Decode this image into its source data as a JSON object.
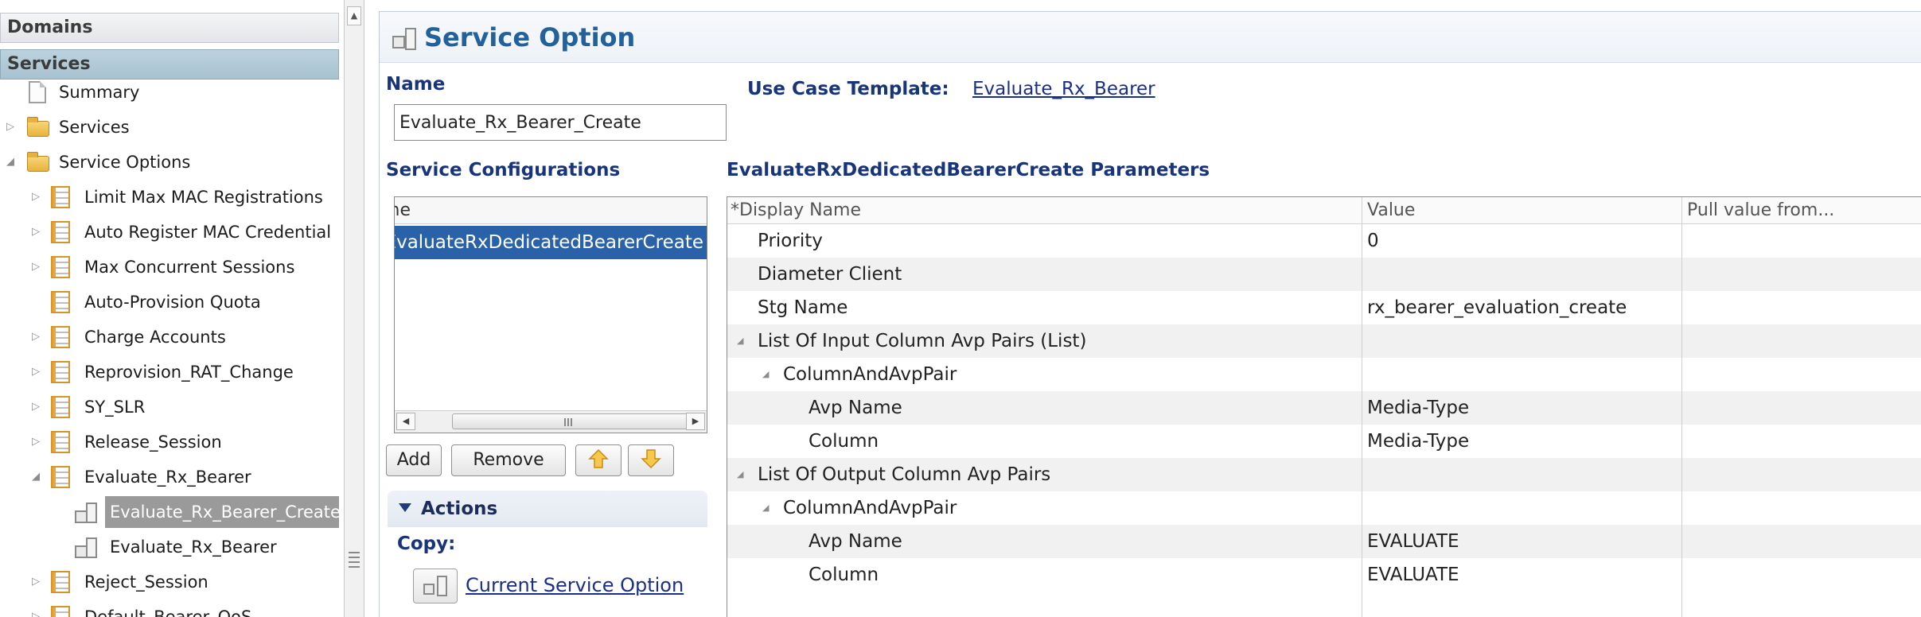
{
  "nav": {
    "domains_label": "Domains",
    "services_label": "Services",
    "tree": [
      {
        "label": "Summary"
      },
      {
        "label": "Services"
      },
      {
        "label": "Service Options"
      },
      {
        "label": "Limit Max MAC Registrations"
      },
      {
        "label": "Auto Register MAC Credential"
      },
      {
        "label": "Max Concurrent Sessions"
      },
      {
        "label": "Auto-Provision Quota"
      },
      {
        "label": "Charge Accounts"
      },
      {
        "label": "Reprovision_RAT_Change"
      },
      {
        "label": "SY_SLR"
      },
      {
        "label": "Release_Session"
      },
      {
        "label": "Evaluate_Rx_Bearer"
      },
      {
        "label": "Evaluate_Rx_Bearer_Create"
      },
      {
        "label": "Evaluate_Rx_Bearer"
      },
      {
        "label": "Reject_Session"
      },
      {
        "label": "Default_Bearer_QoS"
      }
    ]
  },
  "page": {
    "title": "Service Option",
    "name_label": "Name",
    "name_value": "Evaluate_Rx_Bearer_Create",
    "use_case_label": "Use Case Template:",
    "use_case_link": "Evaluate_Rx_Bearer"
  },
  "service_configs": {
    "label": "Service Configurations",
    "column_header": "Name",
    "selected_item": "EvaluateRxDedicatedBearerCreate",
    "buttons": {
      "add": "Add",
      "remove": "Remove"
    }
  },
  "actions": {
    "label": "Actions",
    "copy_label": "Copy:",
    "copy_link": "Current Service Option"
  },
  "params": {
    "title": "EvaluateRxDedicatedBearerCreate Parameters",
    "columns": {
      "display": "*Display Name",
      "value": "Value",
      "pull": "Pull value from..."
    },
    "rows": [
      {
        "name": "Priority",
        "value": "0"
      },
      {
        "name": "Diameter Client",
        "value": ""
      },
      {
        "name": "Stg Name",
        "value": "rx_bearer_evaluation_create"
      },
      {
        "name": "List Of Input Column Avp Pairs (List)",
        "value": ""
      },
      {
        "name": "ColumnAndAvpPair",
        "value": ""
      },
      {
        "name": "Avp Name",
        "value": "Media-Type"
      },
      {
        "name": "Column",
        "value": "Media-Type"
      },
      {
        "name": "List Of Output Column Avp Pairs",
        "value": ""
      },
      {
        "name": "ColumnAndAvpPair",
        "value": ""
      },
      {
        "name": "Avp Name",
        "value": "EVALUATE"
      },
      {
        "name": "Column",
        "value": "EVALUATE"
      }
    ]
  },
  "colors": {
    "title": "#22619b",
    "section_label": "#18347a",
    "selection": "#2962a8",
    "tree_selection": "#9a9a9a"
  }
}
